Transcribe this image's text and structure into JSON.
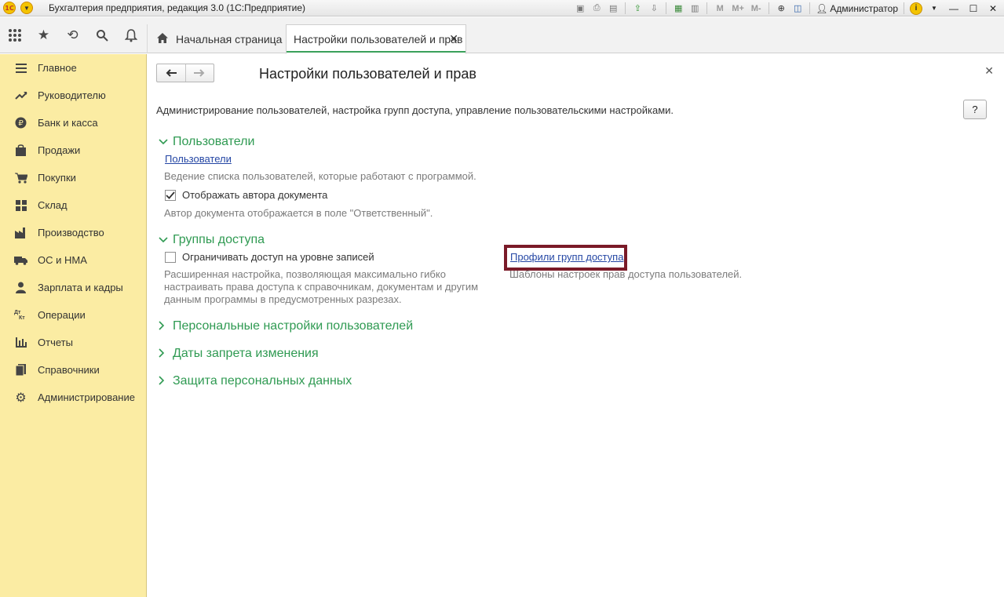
{
  "titlebar": {
    "logo_text": "1С",
    "app_title": "Бухгалтерия предприятия, редакция 3.0  (1С:Предприятие)",
    "user_name": "Администратор",
    "m_label": "M",
    "mplus_label": "M+",
    "mminus_label": "M-"
  },
  "tabs": {
    "home_label": "Начальная страница",
    "active_label": "Настройки пользователей и прав"
  },
  "sidebar": {
    "items": [
      {
        "label": "Главное",
        "icon": "menu-icon"
      },
      {
        "label": "Руководителю",
        "icon": "trend-icon"
      },
      {
        "label": "Банк и касса",
        "icon": "ruble-icon"
      },
      {
        "label": "Продажи",
        "icon": "bag-icon"
      },
      {
        "label": "Покупки",
        "icon": "cart-icon"
      },
      {
        "label": "Склад",
        "icon": "warehouse-icon"
      },
      {
        "label": "Производство",
        "icon": "factory-icon"
      },
      {
        "label": "ОС и НМА",
        "icon": "truck-icon"
      },
      {
        "label": "Зарплата и кадры",
        "icon": "person-icon"
      },
      {
        "label": "Операции",
        "icon": "dt-kt-icon"
      },
      {
        "label": "Отчеты",
        "icon": "chart-icon"
      },
      {
        "label": "Справочники",
        "icon": "book-icon"
      },
      {
        "label": "Администрирование",
        "icon": "gear-icon"
      }
    ]
  },
  "main": {
    "title": "Настройки пользователей и прав",
    "description": "Администрирование пользователей, настройка групп доступа, управление пользовательскими настройками.",
    "help_label": "?",
    "sections": {
      "users": {
        "header": "Пользователи",
        "link": "Пользователи",
        "link_hint": "Ведение списка пользователей, которые работают с программой.",
        "checkbox_label": "Отображать автора документа",
        "checkbox_checked": true,
        "checkbox_hint": "Автор документа отображается в поле \"Ответственный\"."
      },
      "access_groups": {
        "header": "Группы доступа",
        "checkbox_label": "Ограничивать доступ на уровне записей",
        "checkbox_checked": false,
        "checkbox_hint_lines": [
          "Расширенная настройка, позволяющая максимально гибко",
          "настраивать права доступа к справочникам, документам и другим",
          "данным программы в предусмотренных разрезах."
        ],
        "profiles_link": "Профили групп доступа",
        "profiles_hint": "Шаблоны настроек прав доступа пользователей."
      },
      "collapsed": [
        "Персональные настройки пользователей",
        "Даты запрета изменения",
        "Защита персональных данных"
      ]
    }
  },
  "colors": {
    "sidebar_bg": "#fbeca3",
    "group_header": "#2f9a52",
    "link": "#2446a4",
    "highlight_border": "#7a1a28"
  }
}
